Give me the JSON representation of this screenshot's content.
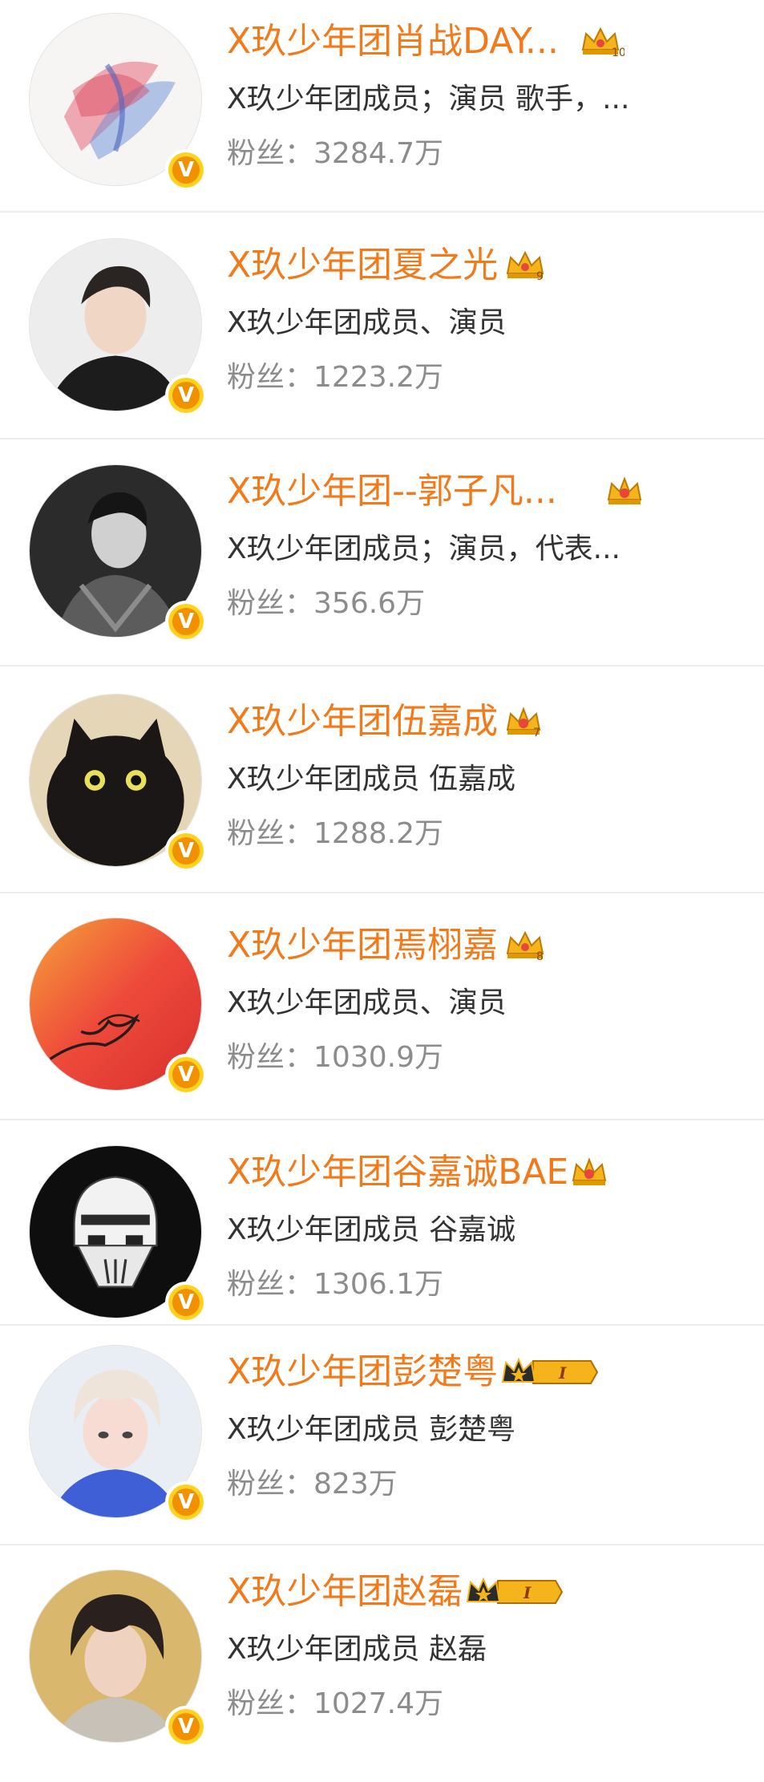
{
  "fans_label": "粉丝：",
  "colors": {
    "name": "#f27a1a",
    "desc": "#333333",
    "fans": "#8c8c8c",
    "verified_badge": "#f29100"
  },
  "users": [
    {
      "name": "X玖少年团肖战DAY...",
      "desc": "X玖少年团成员；演员 歌手，...",
      "fans": "3284.7万",
      "badge_icon": "crown-level-icon",
      "badge_text": "10"
    },
    {
      "name": "X玖少年团夏之光",
      "desc": "X玖少年团成员、演员",
      "fans": "1223.2万",
      "badge_icon": "crown-level-icon",
      "badge_text": "9"
    },
    {
      "name": "X玖少年团--郭子凡...",
      "desc": "X玖少年团成员；演员，代表...",
      "fans": "356.6万",
      "badge_icon": "crown-level-icon",
      "badge_text": ""
    },
    {
      "name": "X玖少年团伍嘉成",
      "desc": "X玖少年团成员  伍嘉成",
      "fans": "1288.2万",
      "badge_icon": "crown-level-icon",
      "badge_text": "7"
    },
    {
      "name": "X玖少年团焉栩嘉",
      "desc": "X玖少年团成员、演员",
      "fans": "1030.9万",
      "badge_icon": "crown-level-icon",
      "badge_text": "8"
    },
    {
      "name": "X玖少年团谷嘉诚BAE",
      "desc": "X玖少年团成员  谷嘉诚",
      "fans": "1306.1万",
      "badge_icon": "crown-level-icon",
      "badge_text": ""
    },
    {
      "name": "X玖少年团彭楚粤",
      "desc": "X玖少年团成员 彭楚粤",
      "fans": "823万",
      "badge_icon": "crown-star-tag-icon",
      "badge_text": "I"
    },
    {
      "name": "X玖少年团赵磊",
      "desc": "X玖少年团成员 赵磊",
      "fans": "1027.4万",
      "badge_icon": "crown-star-tag-icon",
      "badge_text": "I"
    }
  ]
}
